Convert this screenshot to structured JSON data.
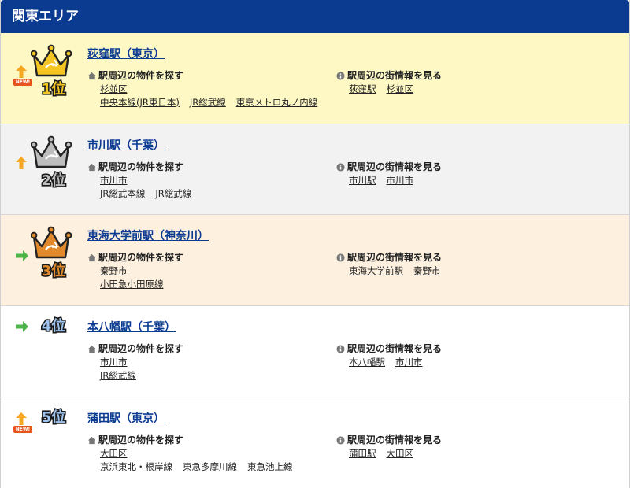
{
  "header": {
    "title": "関東エリア"
  },
  "labels": {
    "property_search": "駅周辺の物件を探す",
    "town_info": "駅周辺の街情報を見る",
    "new_badge": "NEW!"
  },
  "colors": {
    "header_bg": "#0b3b91",
    "link": "#0b3b91",
    "trend_up": "#f5a623",
    "trend_flat": "#4cb648",
    "gold": "#f3c623",
    "silver": "#bdbdbd",
    "bronze": "#e08a2c",
    "rank_blue": "#9ec3ef"
  },
  "rankings": [
    {
      "rank_label": "1位",
      "trend": "up",
      "is_new": true,
      "badge": "gold-crown",
      "station": "荻窪駅（東京）",
      "property_row1": [
        "杉並区"
      ],
      "property_row2": [
        "中央本線(JR東日本)",
        "JR総武線",
        "東京メトロ丸ノ内線"
      ],
      "town_links": [
        "荻窪駅",
        "杉並区"
      ]
    },
    {
      "rank_label": "2位",
      "trend": "up",
      "is_new": false,
      "badge": "silver-crown",
      "station": "市川駅（千葉）",
      "property_row1": [
        "市川市"
      ],
      "property_row2": [
        "JR総武本線",
        "JR総武線"
      ],
      "town_links": [
        "市川駅",
        "市川市"
      ]
    },
    {
      "rank_label": "3位",
      "trend": "flat",
      "is_new": false,
      "badge": "bronze-crown",
      "station": "東海大学前駅（神奈川）",
      "property_row1": [
        "秦野市"
      ],
      "property_row2": [
        "小田急小田原線"
      ],
      "town_links": [
        "東海大学前駅",
        "秦野市"
      ]
    },
    {
      "rank_label": "4位",
      "trend": "flat",
      "is_new": false,
      "badge": "plain-rank",
      "station": "本八幡駅（千葉）",
      "property_row1": [
        "市川市"
      ],
      "property_row2": [
        "JR総武線"
      ],
      "town_links": [
        "本八幡駅",
        "市川市"
      ]
    },
    {
      "rank_label": "5位",
      "trend": "up",
      "is_new": true,
      "badge": "plain-rank",
      "station": "蒲田駅（東京）",
      "property_row1": [
        "大田区"
      ],
      "property_row2": [
        "京浜東北・根岸線",
        "東急多摩川線",
        "東急池上線"
      ],
      "town_links": [
        "蒲田駅",
        "大田区"
      ]
    }
  ]
}
